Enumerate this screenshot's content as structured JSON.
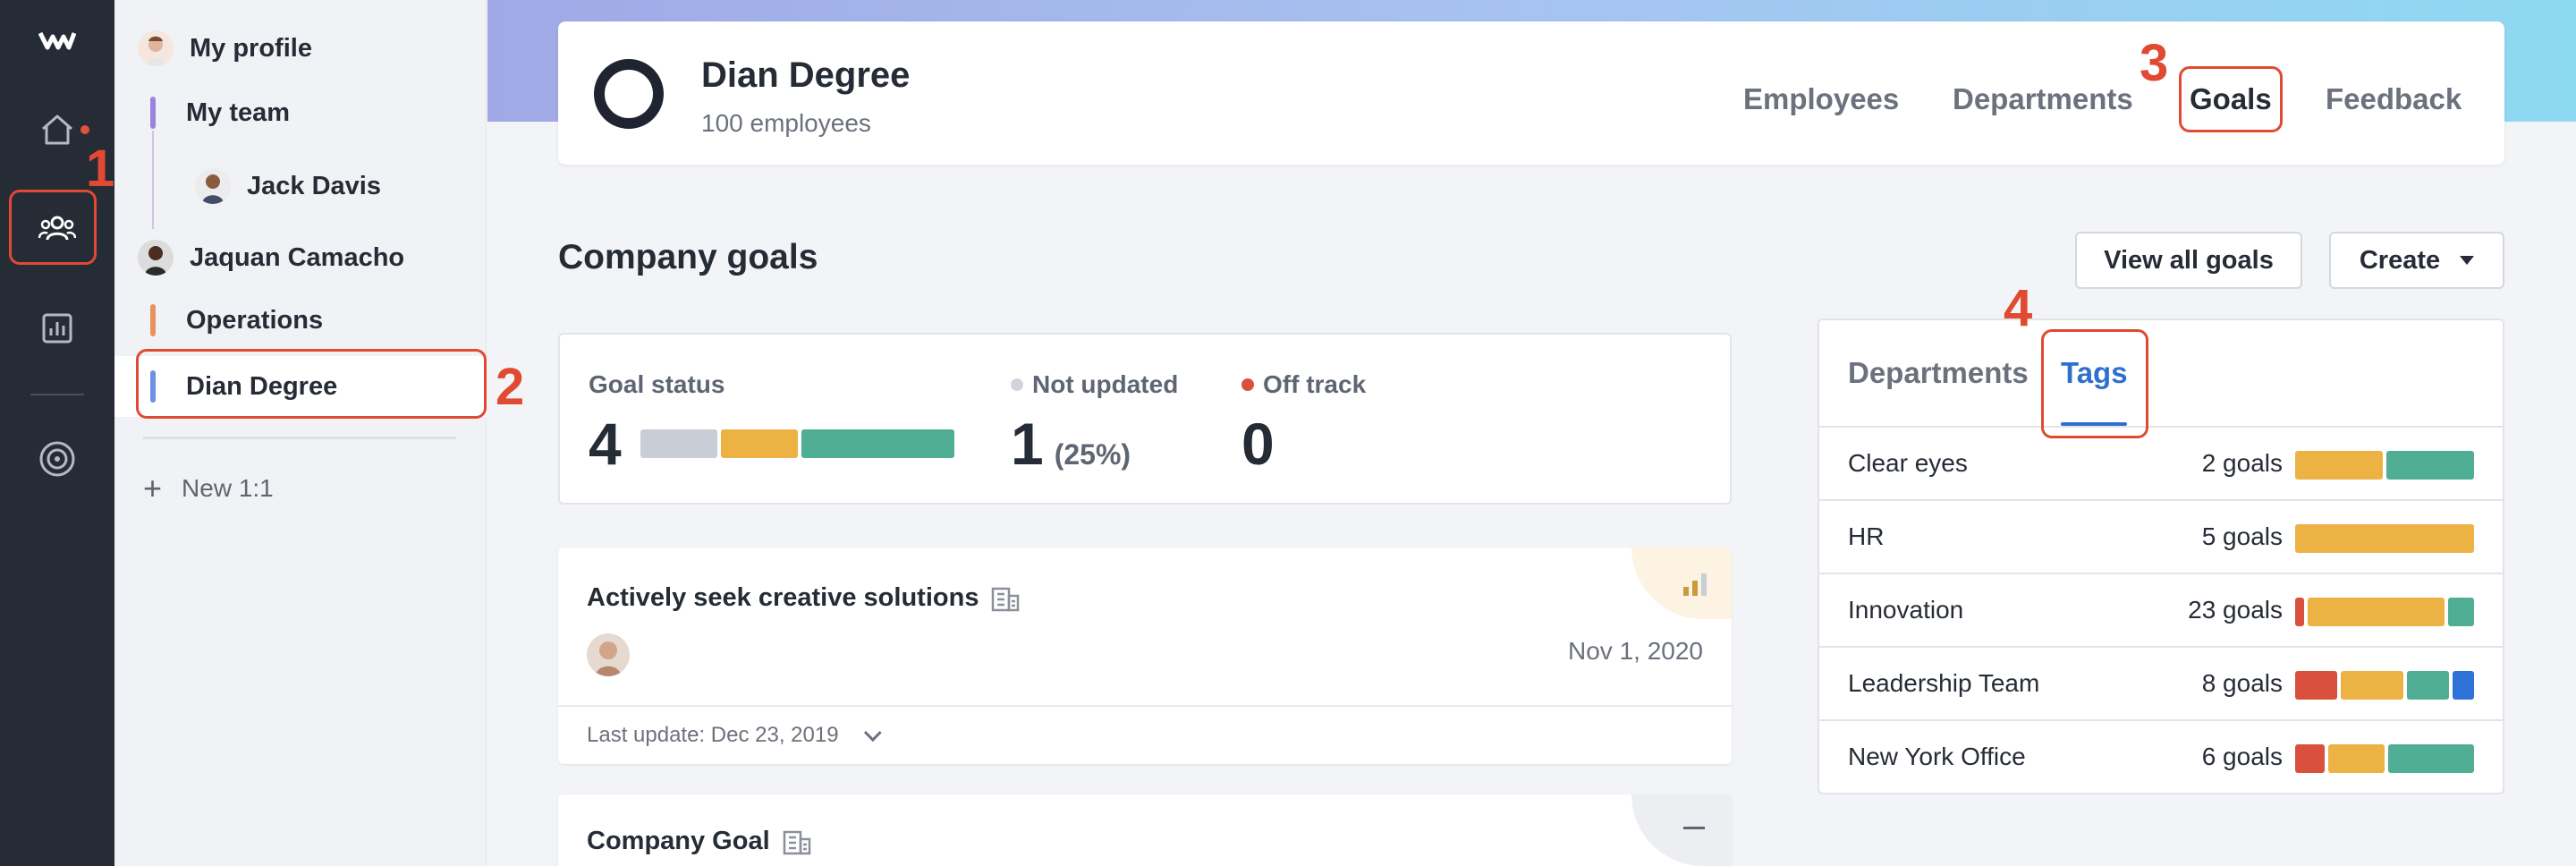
{
  "colors": {
    "green": "#4fae94",
    "yellow": "#ecb244",
    "red": "#d9513d",
    "blue": "#2e72d8",
    "gray": "#c9ced6",
    "accent": "#2f6fce"
  },
  "rail": {
    "icons": [
      "logo-icon",
      "home-icon",
      "people-icon",
      "chart-icon",
      "target-icon"
    ]
  },
  "sidebar": {
    "items": [
      {
        "label": "My profile"
      },
      {
        "label": "My team"
      },
      {
        "label": "Jack Davis"
      },
      {
        "label": "Jaquan Camacho"
      },
      {
        "label": "Operations"
      },
      {
        "label": "Dian Degree"
      }
    ],
    "new_label": "New 1:1"
  },
  "header": {
    "name": "Dian Degree",
    "subtitle": "100 employees",
    "tabs": [
      {
        "label": "Employees"
      },
      {
        "label": "Departments"
      },
      {
        "label": "Goals"
      },
      {
        "label": "Feedback"
      }
    ]
  },
  "main": {
    "title": "Company goals",
    "view_all_label": "View all goals",
    "create_label": "Create"
  },
  "status": {
    "goal_status_label": "Goal status",
    "goal_status_value": "4",
    "bar": [
      0.25,
      0.25,
      0.5
    ],
    "not_updated_label": "Not updated",
    "not_updated_value": "1",
    "not_updated_pct": "(25%)",
    "off_track_label": "Off track",
    "off_track_value": "0"
  },
  "goals": [
    {
      "title": "Actively seek creative solutions",
      "date": "Nov 1, 2020",
      "last_update": "Last update: Dec 23, 2019"
    },
    {
      "title": "Company Goal"
    }
  ],
  "tags_panel": {
    "tab_departments": "Departments",
    "tab_tags": "Tags",
    "rows": [
      {
        "name": "Clear eyes",
        "count": "2 goals",
        "segments": [
          [
            "yellow",
            1
          ],
          [
            "green",
            1
          ]
        ]
      },
      {
        "name": "HR",
        "count": "5 goals",
        "segments": [
          [
            "yellow",
            1
          ]
        ]
      },
      {
        "name": "Innovation",
        "count": "23 goals",
        "segments": [
          [
            "red",
            0.05
          ],
          [
            "yellow",
            0.8
          ],
          [
            "green",
            0.15
          ]
        ]
      },
      {
        "name": "Leadership Team",
        "count": "8 goals",
        "segments": [
          [
            "red",
            0.25
          ],
          [
            "yellow",
            0.37
          ],
          [
            "green",
            0.25
          ],
          [
            "blue",
            0.13
          ]
        ]
      },
      {
        "name": "New York Office",
        "count": "6 goals",
        "segments": [
          [
            "red",
            0.17
          ],
          [
            "yellow",
            0.33
          ],
          [
            "green",
            0.5
          ]
        ]
      }
    ]
  },
  "annotations": [
    "1",
    "2",
    "3",
    "4"
  ]
}
